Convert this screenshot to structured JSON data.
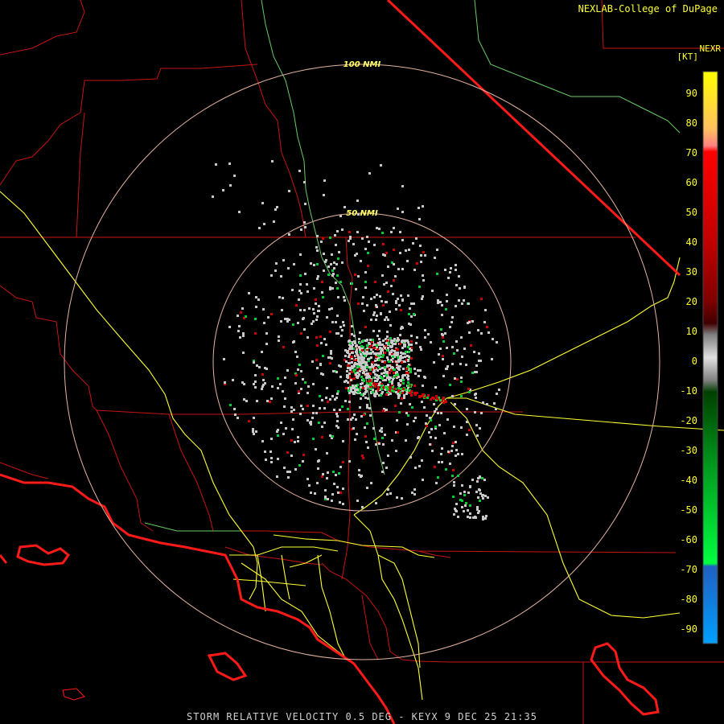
{
  "header": {
    "credit": "NEXLAB-College of DuPage",
    "product": "NEXR",
    "unit": "[KT]"
  },
  "footer": {
    "caption": "STORM RELATIVE VELOCITY 0.5 DEG - KEYX 9 DEC 25 21:35"
  },
  "range_rings": [
    {
      "label": "100 NMI"
    },
    {
      "label": "50 NMI"
    }
  ],
  "color_scale": {
    "ticks": [
      "90",
      "80",
      "70",
      "60",
      "50",
      "40",
      "30",
      "20",
      "10",
      "0",
      "-10",
      "-20",
      "-30",
      "-40",
      "-50",
      "-60",
      "-70",
      "-80",
      "-90"
    ]
  },
  "colors": {
    "background": "#000000",
    "borders": "#c81414",
    "coast": "#ff1a1a",
    "highways": "#ffff33",
    "rivers": "#66cc66",
    "rings": "#e6b4a0",
    "text": "#ffff33",
    "inbound": "#00cc33",
    "outbound": "#cc0000",
    "near_zero": "#c8c8c8"
  }
}
